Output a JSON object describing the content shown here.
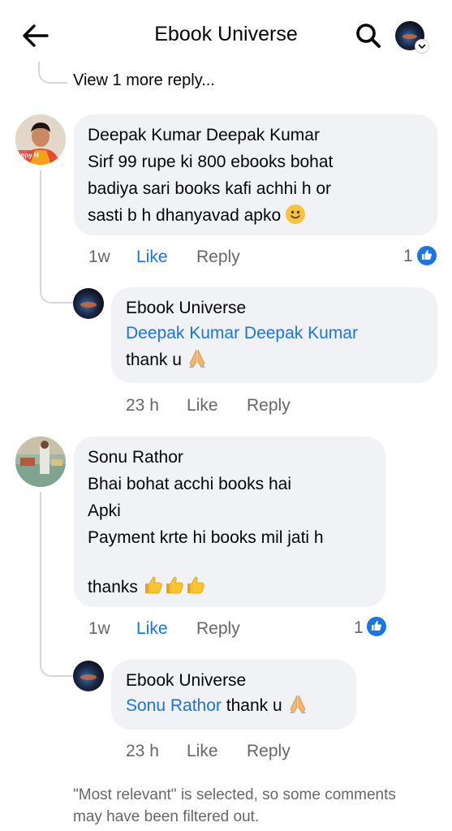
{
  "header": {
    "title": "Ebook Universe",
    "back_icon": "arrow-left-icon",
    "search_icon": "search-icon",
    "profile_icon": "profile-avatar"
  },
  "thread": {
    "view_more": "View 1 more reply..."
  },
  "comments": [
    {
      "author": "Deepak Kumar Deepak Kumar",
      "avatar_text": "appy H",
      "text_lines": [
        "Sirf 99 rupe ki 800 ebooks bohat",
        "badiya sari books kafi achhi h or",
        "sasti b h dhanyavad apko"
      ],
      "emoji": "slightly-smiling-face",
      "time": "1w",
      "like_label": "Like",
      "reply_label": "Reply",
      "reaction_count": "1",
      "reply": {
        "author": "Ebook Universe",
        "mention": "Deepak Kumar Deepak Kumar",
        "text": "thank u",
        "emoji": "folded-hands",
        "time": "23 h",
        "like_label": "Like",
        "reply_label": "Reply"
      }
    },
    {
      "author": "Sonu Rathor",
      "text_lines": [
        "Bhai bohat acchi books hai",
        "Apki",
        "Payment krte hi books mil jati h",
        "",
        "thanks"
      ],
      "emoji": "thumbs-up x3",
      "time": "1w",
      "like_label": "Like",
      "reply_label": "Reply",
      "reaction_count": "1",
      "reply": {
        "author": "Ebook Universe",
        "mention": "Sonu Rathor",
        "text": "thank u",
        "emoji": "folded-hands",
        "time": "23 h",
        "like_label": "Like",
        "reply_label": "Reply"
      }
    }
  ],
  "footer": {
    "note": "\"Most relevant\" is selected, so some comments may have been filtered out."
  },
  "colors": {
    "link_blue": "#1b74e4",
    "bubble_bg": "#f0f2f5",
    "meta_gray": "#65676b",
    "thread_line": "#d4d7db"
  }
}
